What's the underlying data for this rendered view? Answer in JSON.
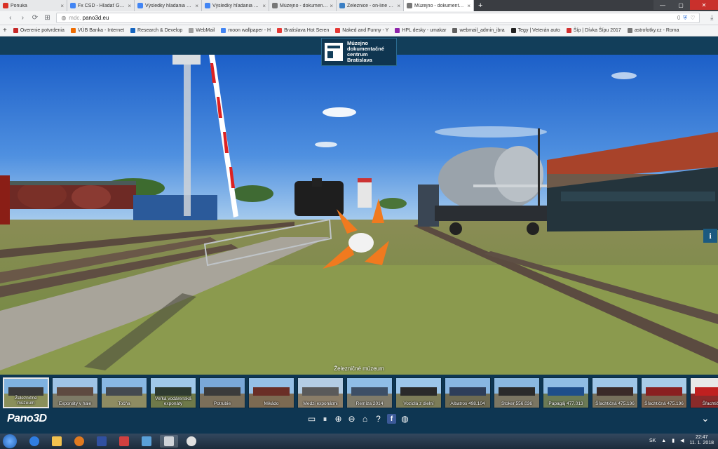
{
  "browser": {
    "tabs": [
      {
        "label": "Ponuka",
        "color": "#d93025",
        "active": false
      },
      {
        "label": "Fx ČSD - Hľadať Googlom",
        "color": "#4285f4",
        "active": false
      },
      {
        "label": "Výsledky hľadania služby",
        "color": "#4285f4",
        "active": false
      },
      {
        "label": "Výsledky hľadania služby",
        "color": "#4285f4",
        "active": false
      },
      {
        "label": "Múzejno - dokumentačné",
        "color": "#777777",
        "active": false
      },
      {
        "label": "Železnice - on-line kamery",
        "color": "#3b7fc4",
        "active": false
      },
      {
        "label": "Múzejno - dokumentačné",
        "color": "#777777",
        "active": true
      }
    ],
    "url_prefix": "mdc.",
    "url": "pano3d.eu",
    "url_badge": "0",
    "bookmarks": [
      {
        "label": "Overenie potvrdenia",
        "color": "#c62828"
      },
      {
        "label": "VÚB Banka - Internet",
        "color": "#ef6c00"
      },
      {
        "label": "Research & Develop",
        "color": "#1565c0"
      },
      {
        "label": "WebMail",
        "color": "#9e9e9e"
      },
      {
        "label": "moon wallpaper - H",
        "color": "#4285f4"
      },
      {
        "label": "Bratislava Hot Seren",
        "color": "#e53935"
      },
      {
        "label": "Naked and Funny - Y",
        "color": "#e53935"
      },
      {
        "label": "HPL desky - umakar",
        "color": "#8e24aa"
      },
      {
        "label": "webmail_admin_ibra",
        "color": "#616161"
      },
      {
        "label": "Tegy | Veterán auto",
        "color": "#212121"
      },
      {
        "label": "Šíp | Dívka Šípu 2017",
        "color": "#d32f2f"
      },
      {
        "label": "astrofotky.cz - Roma",
        "color": "#757575"
      }
    ]
  },
  "museum": {
    "logo_text": "Múzejno\ndokumentačné\ncentrum\nBratislava",
    "scene_title": "Železničné múzeum",
    "brand": "Pano3D",
    "thumbnails": [
      {
        "caption": "Železničné múzeum",
        "sky": "#7fb2e0",
        "ground": "#8a8f5a",
        "obj": "#3a3a3a",
        "active": true
      },
      {
        "caption": "Exponáty v hale",
        "sky": "#9fc4e6",
        "ground": "#7d7a66",
        "obj": "#5e4a40",
        "active": false
      },
      {
        "caption": "Točňa",
        "sky": "#88b8e4",
        "ground": "#8e8c62",
        "obj": "#444a50",
        "active": false
      },
      {
        "caption": "Veľká vodárenská exponáty",
        "sky": "#a0c8ea",
        "ground": "#6f7a4a",
        "obj": "#2e3a30",
        "active": false
      },
      {
        "caption": "Potrubie",
        "sky": "#7aa8d8",
        "ground": "#7b6f5a",
        "obj": "#3b3b3b",
        "active": false
      },
      {
        "caption": "Mikádo",
        "sky": "#96c0e6",
        "ground": "#7c6a52",
        "obj": "#6a2e26",
        "active": false
      },
      {
        "caption": "Medzi exponátmi",
        "sky": "#b4cde4",
        "ground": "#8a7d68",
        "obj": "#5a5a5a",
        "active": false
      },
      {
        "caption": "Remíza 2014",
        "sky": "#8fbde6",
        "ground": "#7f7b6a",
        "obj": "#3d4f66",
        "active": false
      },
      {
        "caption": "Vozidlá z dielní",
        "sky": "#9cc6ea",
        "ground": "#7c7c58",
        "obj": "#2a2a2a",
        "active": false
      },
      {
        "caption": "Albatros 498.104",
        "sky": "#88b6e2",
        "ground": "#6d6a52",
        "obj": "#2e3e5a",
        "active": false
      },
      {
        "caption": "Stoker 556.036",
        "sky": "#8ab8e0",
        "ground": "#7b7663",
        "obj": "#2b2b2b",
        "active": false
      },
      {
        "caption": "Papagáj 477.013",
        "sky": "#90bde4",
        "ground": "#6b7a55",
        "obj": "#1f4e8a",
        "active": false
      },
      {
        "caption": "Šľachtičná 475.196",
        "sky": "#9fc6e8",
        "ground": "#76705c",
        "obj": "#3a2a28",
        "active": false
      },
      {
        "caption": "Šľachtičná 475.196",
        "sky": "#a8cbe8",
        "ground": "#7a6450",
        "obj": "#8a2020",
        "active": false
      },
      {
        "caption": "Šľachtičná",
        "sky": "#e8e8e8",
        "ground": "#8a2a2a",
        "obj": "#c02020",
        "active": false
      }
    ],
    "controls": [
      "autorotate-icon",
      "zoom-in-icon",
      "zoom-out-icon",
      "home-icon",
      "help-icon",
      "facebook-icon",
      "globe-icon"
    ]
  },
  "taskbar": {
    "lang": "SK",
    "time": "22:47",
    "date": "11. 1. 2018"
  }
}
